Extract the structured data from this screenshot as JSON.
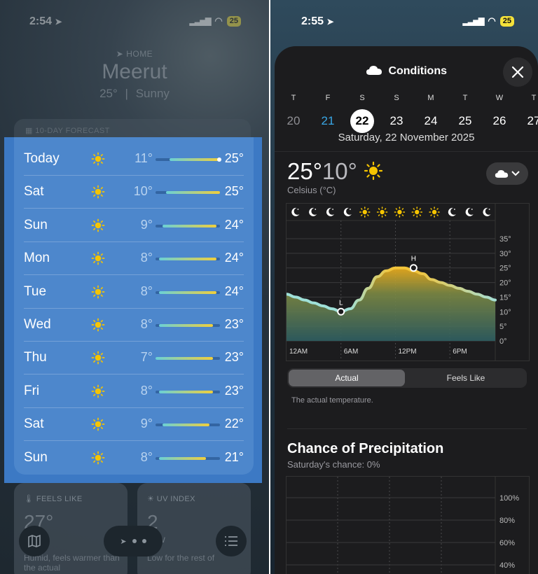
{
  "left_screen": {
    "status": {
      "time": "2:54",
      "battery": "25"
    },
    "location_label": "HOME",
    "city": "Meerut",
    "current_temp": "25°",
    "current_sep": "|",
    "current_condition": "Sunny",
    "forecast_header": "10-DAY FORECAST",
    "forecast": [
      {
        "day": "Today",
        "low": "11°",
        "high": "25°",
        "icon": "sun-icon"
      },
      {
        "day": "Sat",
        "low": "10°",
        "high": "25°",
        "icon": "sun-icon"
      },
      {
        "day": "Sun",
        "low": "9°",
        "high": "24°",
        "icon": "sun-icon"
      },
      {
        "day": "Mon",
        "low": "8°",
        "high": "24°",
        "icon": "sun-icon"
      },
      {
        "day": "Tue",
        "low": "8°",
        "high": "24°",
        "icon": "sun-icon"
      },
      {
        "day": "Wed",
        "low": "8°",
        "high": "23°",
        "icon": "sun-icon"
      },
      {
        "day": "Thu",
        "low": "7°",
        "high": "23°",
        "icon": "sun-icon"
      },
      {
        "day": "Fri",
        "low": "8°",
        "high": "23°",
        "icon": "sun-icon"
      },
      {
        "day": "Sat",
        "low": "9°",
        "high": "22°",
        "icon": "sun-icon"
      },
      {
        "day": "Sun",
        "low": "8°",
        "high": "21°",
        "icon": "sun-icon"
      }
    ],
    "feels_like": {
      "label": "FEELS LIKE",
      "value": "27°",
      "note": "Humid, feels warmer than the actual"
    },
    "uv_index": {
      "label": "UV INDEX",
      "value": "2",
      "level": "Low",
      "note": "Low for the rest of"
    }
  },
  "right_screen": {
    "status": {
      "time": "2:55",
      "battery": "25"
    },
    "title": "Conditions",
    "weekdays": [
      "T",
      "F",
      "S",
      "S",
      "M",
      "T",
      "W",
      "T"
    ],
    "dates": [
      "20",
      "21",
      "22",
      "23",
      "24",
      "25",
      "26",
      "27"
    ],
    "selected_date_index": 2,
    "today_date_index": 1,
    "selected_date_label": "Saturday, 22 November 2025",
    "high": "25°",
    "low": "10°",
    "unit_label": "Celsius (°C)",
    "segments": {
      "actual": "Actual",
      "feels_like": "Feels Like"
    },
    "description": "The actual temperature.",
    "precip_title": "Chance of Precipitation",
    "precip_sub": "Saturday's chance: 0%",
    "colors": {
      "accent_blue": "#39a7e6",
      "sun_yellow": "#f5c400"
    }
  },
  "chart_data": [
    {
      "type": "area",
      "title": "",
      "x": [
        "12AM",
        "1AM",
        "2AM",
        "3AM",
        "4AM",
        "5AM",
        "6AM",
        "7AM",
        "8AM",
        "9AM",
        "10AM",
        "11AM",
        "12PM",
        "1PM",
        "2PM",
        "3PM",
        "4PM",
        "5PM",
        "6PM",
        "7PM",
        "8PM",
        "9PM",
        "10PM",
        "11PM"
      ],
      "x_tick_labels": [
        "12AM",
        "6AM",
        "12PM",
        "6PM"
      ],
      "series": [
        {
          "values": [
            16,
            15,
            14,
            13,
            12,
            11,
            10,
            11,
            14,
            18,
            22,
            24,
            25,
            25,
            24,
            23,
            21,
            20,
            19,
            18,
            17,
            16,
            15,
            14
          ]
        }
      ],
      "annotations": [
        {
          "label": "L",
          "x": "6AM",
          "y": 10
        },
        {
          "label": "H",
          "x": "2PM",
          "y": 25
        }
      ],
      "hour_icons": [
        "moon",
        "moon",
        "moon",
        "moon",
        "sun",
        "sun",
        "sun",
        "sun",
        "sun",
        "moon",
        "moon",
        "moon"
      ],
      "yticks": [
        "0°",
        "5°",
        "10°",
        "15°",
        "20°",
        "25°",
        "30°",
        "35°"
      ],
      "ylim": [
        0,
        35
      ],
      "grid": true
    },
    {
      "type": "bar",
      "title": "Chance of Precipitation",
      "yticks": [
        "40%",
        "60%",
        "80%",
        "100%"
      ],
      "ylim": [
        0,
        100
      ],
      "values": [
        0
      ],
      "grid": true
    }
  ]
}
